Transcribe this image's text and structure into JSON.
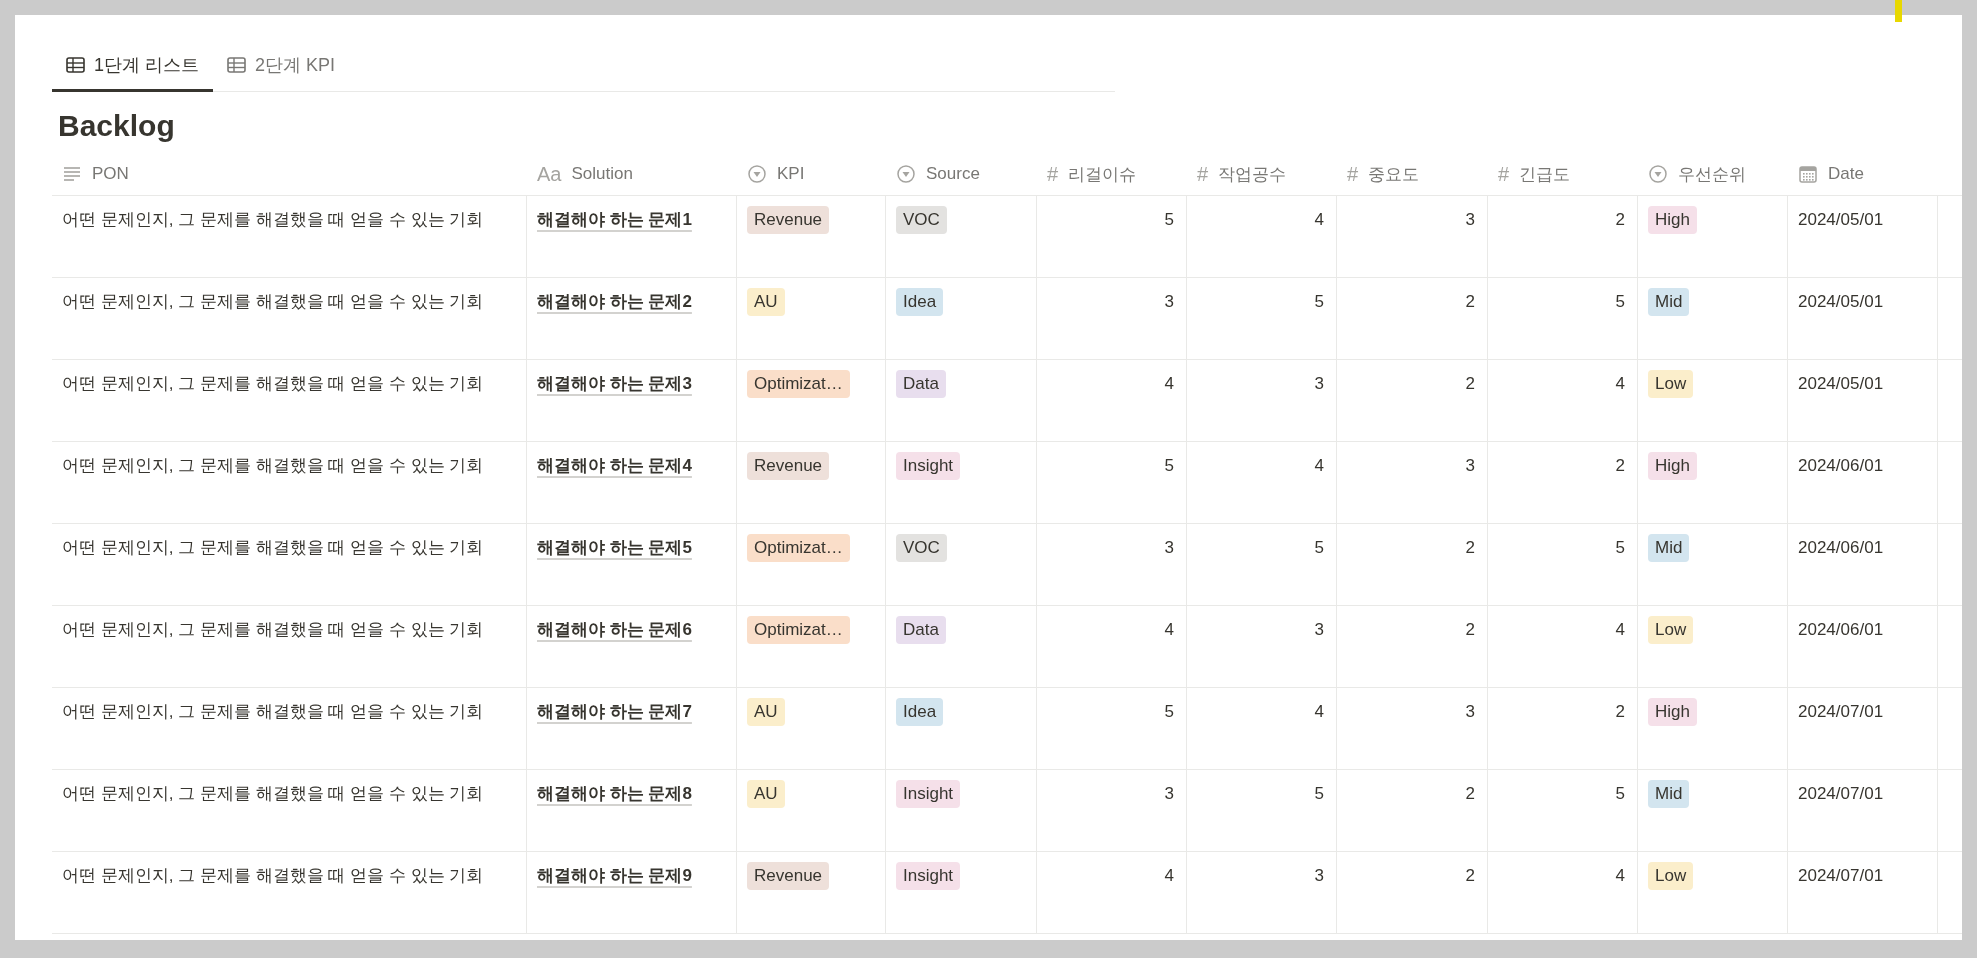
{
  "tabs": [
    {
      "label": "1단계 리스트",
      "selected": true
    },
    {
      "label": "2단계 KPI",
      "selected": false
    }
  ],
  "title": "Backlog",
  "table": {
    "columns": [
      {
        "label": "PON",
        "kind": "text"
      },
      {
        "label": "Solution",
        "kind": "title",
        "icon": "Aa"
      },
      {
        "label": "KPI",
        "kind": "select"
      },
      {
        "label": "Source",
        "kind": "select"
      },
      {
        "label": "리걸이슈",
        "kind": "number",
        "icon": "#"
      },
      {
        "label": "작업공수",
        "kind": "number",
        "icon": "#"
      },
      {
        "label": "중요도",
        "kind": "number",
        "icon": "#"
      },
      {
        "label": "긴급도",
        "kind": "number",
        "icon": "#"
      },
      {
        "label": "우선순위",
        "kind": "select"
      },
      {
        "label": "Date",
        "kind": "date"
      }
    ],
    "rows": [
      {
        "cells": [
          "어떤 문제인지, 그 문제를 해결했을 때 얻을 수 있는 기회",
          "해결해야 하는 문제1",
          {
            "label": "Revenue",
            "color": "#eee0da"
          },
          {
            "label": "VOC",
            "color": "#e3e2e0"
          },
          "5",
          "4",
          "3",
          "2",
          {
            "label": "High",
            "color": "#f5e0e9"
          },
          "2024/05/01"
        ]
      },
      {
        "cells": [
          "어떤 문제인지, 그 문제를 해결했을 때 얻을 수 있는 기회",
          "해결해야 하는 문제2",
          {
            "label": "AU",
            "color": "#fbeecb"
          },
          {
            "label": "Idea",
            "color": "#d3e5ef"
          },
          "3",
          "5",
          "2",
          "5",
          {
            "label": "Mid",
            "color": "#d3e5ef"
          },
          "2024/05/01"
        ]
      },
      {
        "cells": [
          "어떤 문제인지, 그 문제를 해결했을 때 얻을 수 있는 기회",
          "해결해야 하는 문제3",
          {
            "label": "Optimizat…",
            "color": "#fadec9"
          },
          {
            "label": "Data",
            "color": "#e8deee"
          },
          "4",
          "3",
          "2",
          "4",
          {
            "label": "Low",
            "color": "#fbeecb"
          },
          "2024/05/01"
        ]
      },
      {
        "cells": [
          "어떤 문제인지, 그 문제를 해결했을 때 얻을 수 있는 기회",
          "해결해야 하는 문제4",
          {
            "label": "Revenue",
            "color": "#eee0da"
          },
          {
            "label": "Insight",
            "color": "#f5e0e9"
          },
          "5",
          "4",
          "3",
          "2",
          {
            "label": "High",
            "color": "#f5e0e9"
          },
          "2024/06/01"
        ]
      },
      {
        "cells": [
          "어떤 문제인지, 그 문제를 해결했을 때 얻을 수 있는 기회",
          "해결해야 하는 문제5",
          {
            "label": "Optimizat…",
            "color": "#fadec9"
          },
          {
            "label": "VOC",
            "color": "#e3e2e0"
          },
          "3",
          "5",
          "2",
          "5",
          {
            "label": "Mid",
            "color": "#d3e5ef"
          },
          "2024/06/01"
        ]
      },
      {
        "cells": [
          "어떤 문제인지, 그 문제를 해결했을 때 얻을 수 있는 기회",
          "해결해야 하는 문제6",
          {
            "label": "Optimizat…",
            "color": "#fadec9"
          },
          {
            "label": "Data",
            "color": "#e8deee"
          },
          "4",
          "3",
          "2",
          "4",
          {
            "label": "Low",
            "color": "#fbeecb"
          },
          "2024/06/01"
        ]
      },
      {
        "cells": [
          "어떤 문제인지, 그 문제를 해결했을 때 얻을 수 있는 기회",
          "해결해야 하는 문제7",
          {
            "label": "AU",
            "color": "#fbeecb"
          },
          {
            "label": "Idea",
            "color": "#d3e5ef"
          },
          "5",
          "4",
          "3",
          "2",
          {
            "label": "High",
            "color": "#f5e0e9"
          },
          "2024/07/01"
        ]
      },
      {
        "cells": [
          "어떤 문제인지, 그 문제를 해결했을 때 얻을 수 있는 기회",
          "해결해야 하는 문제8",
          {
            "label": "AU",
            "color": "#fbeecb"
          },
          {
            "label": "Insight",
            "color": "#f5e0e9"
          },
          "3",
          "5",
          "2",
          "5",
          {
            "label": "Mid",
            "color": "#d3e5ef"
          },
          "2024/07/01"
        ]
      },
      {
        "cells": [
          "어떤 문제인지, 그 문제를 해결했을 때 얻을 수 있는 기회",
          "해결해야 하는 문제9",
          {
            "label": "Revenue",
            "color": "#eee0da"
          },
          {
            "label": "Insight",
            "color": "#f5e0e9"
          },
          "4",
          "3",
          "2",
          "4",
          {
            "label": "Low",
            "color": "#fbeecb"
          },
          "2024/07/01"
        ]
      }
    ]
  }
}
